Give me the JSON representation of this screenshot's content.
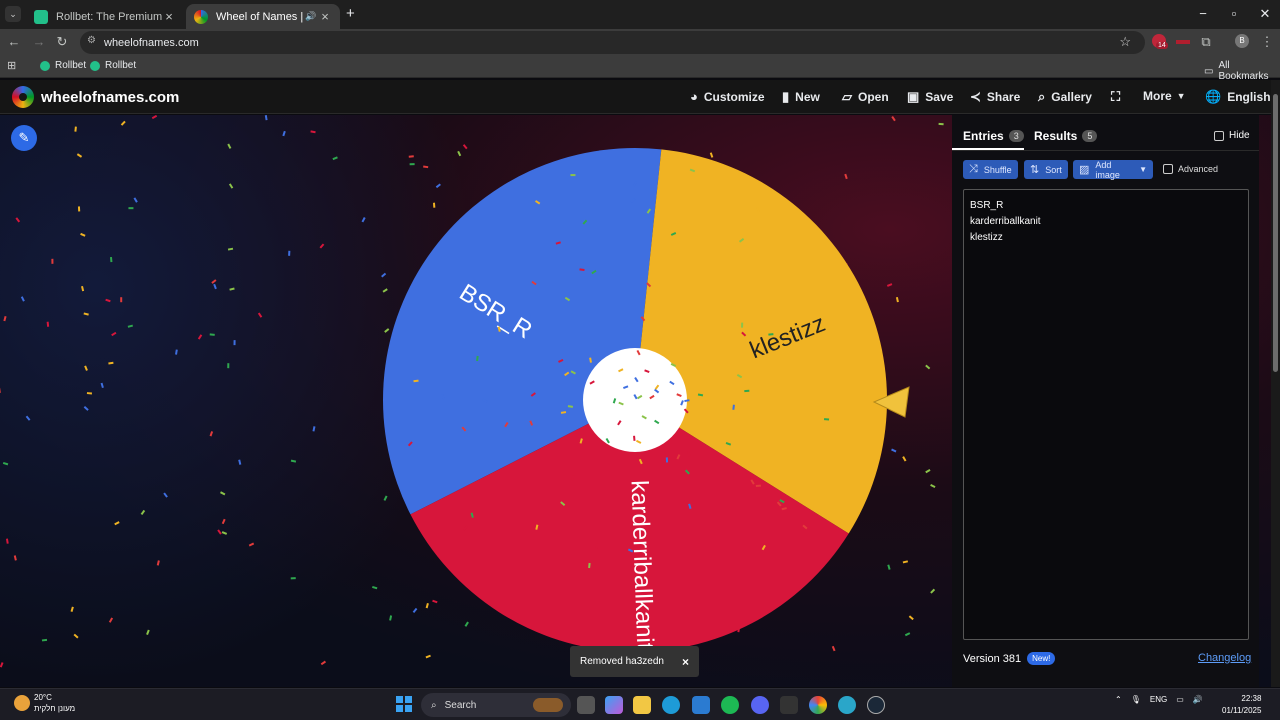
{
  "browser": {
    "tabs": [
      {
        "title": "Rollbet: The Premium Sweepsta",
        "active": false
      },
      {
        "title": "Wheel of Names | Random",
        "active": true
      }
    ],
    "url": "wheelofnames.com",
    "bookmarks": [
      "Rollbet",
      "Rollbet"
    ],
    "all_bookmarks": "All Bookmarks",
    "extension_badge": "14",
    "profile_initial": "B"
  },
  "site": {
    "logo": "wheelofnames.com",
    "nav": {
      "customize": "Customize",
      "new": "New",
      "open": "Open",
      "save": "Save",
      "share": "Share",
      "gallery": "Gallery",
      "more": "More",
      "language": "English"
    }
  },
  "wheel": {
    "segments": [
      {
        "label": "BSR_R",
        "color": "#3f6fe0"
      },
      {
        "label": "klestizz",
        "color": "#f0b323"
      },
      {
        "label": "karderriballkanit",
        "color": "#d7163b"
      }
    ]
  },
  "panel": {
    "tabs": {
      "entries": "Entries",
      "entries_count": "3",
      "results": "Results",
      "results_count": "5"
    },
    "hide_label": "Hide",
    "buttons": {
      "shuffle": "Shuffle",
      "sort": "Sort",
      "add_image": "Add image"
    },
    "advanced_label": "Advanced",
    "entries": [
      "BSR_R",
      "karderriballkanit",
      "klestizz"
    ],
    "version": "Version 381",
    "new_badge": "New!",
    "changelog": "Changelog"
  },
  "toast": {
    "message": "Removed ha3zedn",
    "close": "×"
  },
  "taskbar": {
    "weather_temp": "20°C",
    "weather_desc": "מעונן חלקית",
    "search": "Search",
    "language": "ENG",
    "time": "22:38",
    "date": "01/11/2025"
  },
  "colors": {
    "accent": "#2d6ae6",
    "blue": "#3f6fe0",
    "yellow": "#f0b323",
    "red": "#d7163b"
  }
}
